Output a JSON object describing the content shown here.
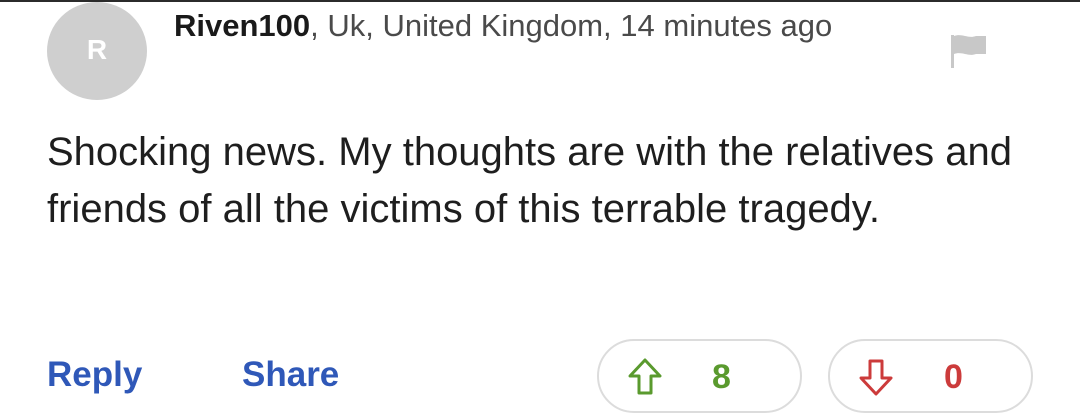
{
  "comment": {
    "avatar_initial": "R",
    "username": "Riven100",
    "location_time": ", Uk, United Kingdom, 14 minutes ago",
    "body": "Shocking news. My thoughts are with the relatives and friends of all the victims of this terrable tragedy."
  },
  "actions": {
    "reply_label": "Reply",
    "share_label": "Share"
  },
  "votes": {
    "up_count": "8",
    "down_count": "0"
  },
  "colors": {
    "link": "#2f58b8",
    "upvote": "#5a9a2e",
    "downvote": "#cc3b3b",
    "avatar_bg": "#cfcfcf",
    "flag": "#c8c8c8"
  },
  "icons": {
    "flag": "flag-icon",
    "up": "arrow-up-icon",
    "down": "arrow-down-icon"
  }
}
